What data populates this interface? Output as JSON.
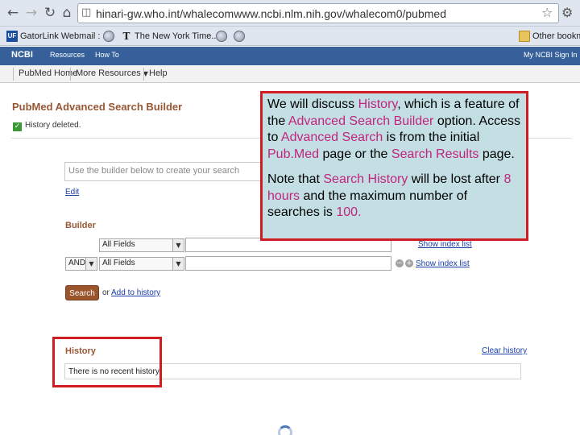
{
  "browser": {
    "url": "hinari-gw.who.int/whalecomwww.ncbi.nlm.nih.gov/whalecom0/pubmed",
    "bookmarks": [
      "GatorLink Webmail : ...",
      "The New York Time...",
      "Other bookm"
    ]
  },
  "ncbi_bar": {
    "logo": "NCBI",
    "resources": "Resources",
    "how_to": "How To",
    "signin": "My NCBI  Sign In"
  },
  "pubmed_menu": {
    "home": "PubMed Home",
    "more_resources": "More Resources",
    "help": "Help"
  },
  "page": {
    "title": "PubMed Advanced Search Builder",
    "history_deleted": "History deleted.",
    "search_placeholder": "Use the builder below to create your search",
    "edit_link": "Edit",
    "builder_label": "Builder",
    "rows": [
      {
        "operator": "",
        "field": "All Fields",
        "index_link": "Show index list"
      },
      {
        "operator": "AND",
        "field": "All Fields",
        "index_link": "Show index list"
      }
    ],
    "search_button": "Search",
    "or_text": "or",
    "add_to_history": "Add to history",
    "history_label": "History",
    "clear_history": "Clear history",
    "no_history": "There is no recent history"
  },
  "callout": {
    "p1": [
      {
        "text": "We will discuss ",
        "hl": false
      },
      {
        "text": "History",
        "hl": true
      },
      {
        "text": ", which is a feature of the ",
        "hl": false
      },
      {
        "text": "Advanced Search Builder",
        "hl": true
      },
      {
        "text": " option. Access to ",
        "hl": false
      },
      {
        "text": "Advanced Search",
        "hl": true
      },
      {
        "text": " is from the initial ",
        "hl": false
      },
      {
        "text": "Pub.Med",
        "hl": true
      },
      {
        "text": " page or the ",
        "hl": false
      },
      {
        "text": "Search Results",
        "hl": true
      },
      {
        "text": " page.",
        "hl": false
      }
    ],
    "p2": [
      {
        "text": "Note that ",
        "hl": false
      },
      {
        "text": "Search History",
        "hl": true
      },
      {
        "text": " will be lost after ",
        "hl": false
      },
      {
        "text": "8 hours",
        "hl": true
      },
      {
        "text": " and the maximum number of searches is ",
        "hl": false
      },
      {
        "text": "100.",
        "hl": true
      }
    ]
  },
  "colors": {
    "highlight_border": "#d11c22",
    "callout_bg": "#c3dfe3",
    "callout_highlight": "#c2247f",
    "ncbi_blue": "#35609a"
  }
}
